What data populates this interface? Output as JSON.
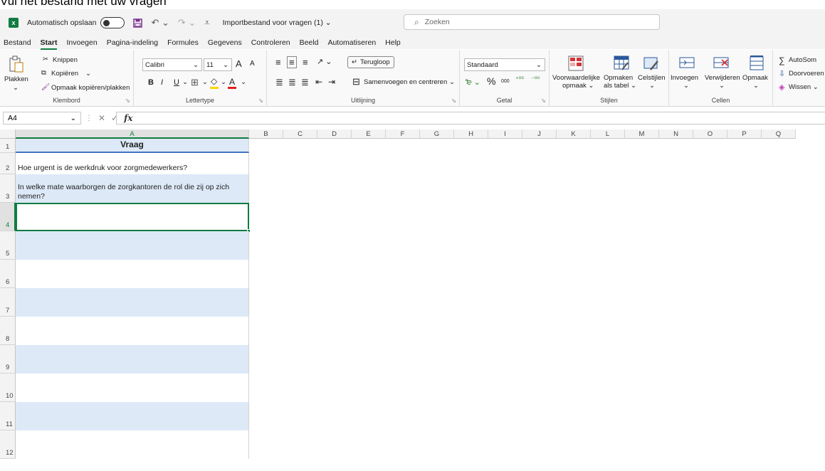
{
  "caption": "Vul het bestand met uw vragen",
  "titlebar": {
    "autosave_label": "Automatisch opslaan",
    "doc_title": "Importbestand voor vragen (1) ⌄",
    "search_placeholder": "Zoeken",
    "app_logo_letter": "x"
  },
  "tabs": [
    "Bestand",
    "Start",
    "Invoegen",
    "Pagina-indeling",
    "Formules",
    "Gegevens",
    "Controleren",
    "Beeld",
    "Automatiseren",
    "Help"
  ],
  "active_tab_index": 1,
  "ribbon": {
    "clipboard": {
      "label": "Klembord",
      "paste": "Plakken",
      "paste_arrow": "⌄",
      "cut": "Knippen",
      "copy": "Kopiëren",
      "copy_arrow": "⌄",
      "format_painter": "Opmaak kopiëren/plakken"
    },
    "font": {
      "label": "Lettertype",
      "family": "Calibri",
      "size": "11",
      "bold": "B",
      "italic": "I",
      "underline": "U",
      "grow": "A",
      "shrink": "A"
    },
    "alignment": {
      "label": "Uitlijning",
      "wrap": "Terugloop",
      "merge": "Samenvoegen en centreren"
    },
    "number": {
      "label": "Getal",
      "format": "Standaard",
      "percent": "%",
      "thousands": "000",
      "inc_decimals": "←,0\n,00",
      "dec_decimals": ",00\n→,0"
    },
    "styles": {
      "label": "Stijlen",
      "conditional": "Voorwaardelijke",
      "conditional2": "opmaak ⌄",
      "as_table": "Opmaken",
      "as_table2": "als tabel ⌄",
      "cell_styles": "Celstijlen",
      "cell_styles2": "⌄"
    },
    "cells": {
      "label": "Cellen",
      "insert": "Invoegen",
      "insert2": "⌄",
      "delete": "Verwijderen",
      "delete2": "⌄",
      "format": "Opmaak",
      "format2": "⌄"
    },
    "editing": {
      "autosum": "AutoSom",
      "fill": "Doorvoeren",
      "clear": "Wissen ⌄"
    },
    "colors": {
      "accent": "#107c41",
      "fill_color": "#ffd400",
      "font_color": "#e02020"
    }
  },
  "formula_bar": {
    "name_box": "A4",
    "fx": "fx",
    "value": ""
  },
  "sheet": {
    "columns": [
      "A",
      "B",
      "C",
      "D",
      "E",
      "F",
      "G",
      "H",
      "I",
      "J",
      "K",
      "L",
      "M",
      "N",
      "O",
      "P",
      "Q"
    ],
    "selected_column": "A",
    "rows": [
      {
        "num": "1",
        "text": "Vraag"
      },
      {
        "num": "2",
        "text": "Hoe urgent is de werkdruk voor zorgmedewerkers?"
      },
      {
        "num": "3",
        "text": "In welke mate waarborgen de zorgkantoren de rol die zij op zich nemen?"
      },
      {
        "num": "4",
        "text": ""
      },
      {
        "num": "5",
        "text": ""
      },
      {
        "num": "6",
        "text": ""
      },
      {
        "num": "7",
        "text": ""
      },
      {
        "num": "8",
        "text": ""
      },
      {
        "num": "9",
        "text": ""
      },
      {
        "num": "10",
        "text": ""
      },
      {
        "num": "11",
        "text": ""
      },
      {
        "num": "12",
        "text": ""
      }
    ],
    "active_cell": "A4",
    "band_color": "#dde9f7",
    "header_border_color": "#4472c4"
  }
}
